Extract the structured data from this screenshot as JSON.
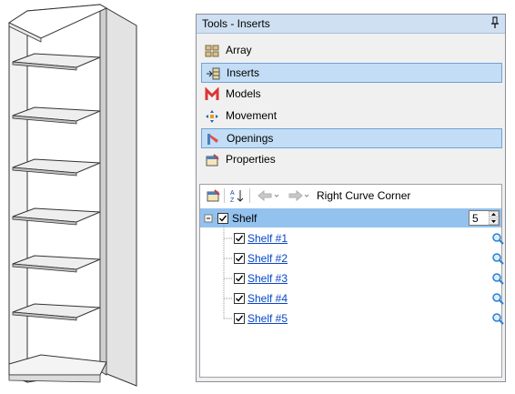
{
  "panel": {
    "title": "Tools - Inserts",
    "categories": [
      {
        "label": "Array",
        "icon": "array-icon",
        "selected": false
      },
      {
        "label": "Inserts",
        "icon": "inserts-icon",
        "selected": true
      },
      {
        "label": "Models",
        "icon": "models-icon",
        "selected": false
      },
      {
        "label": "Movement",
        "icon": "movement-icon",
        "selected": false
      },
      {
        "label": "Openings",
        "icon": "openings-icon",
        "selected": true
      },
      {
        "label": "Properties",
        "icon": "properties-icon",
        "selected": false
      }
    ]
  },
  "tree": {
    "breadcrumb": "Right Curve Corner",
    "root": {
      "label": "Shelf",
      "checked": true,
      "count": "5"
    },
    "children": [
      {
        "label": "Shelf #1",
        "checked": true
      },
      {
        "label": "Shelf #2",
        "checked": true
      },
      {
        "label": "Shelf #3",
        "checked": true
      },
      {
        "label": "Shelf #4",
        "checked": true
      },
      {
        "label": "Shelf #5",
        "checked": true
      }
    ]
  },
  "colors": {
    "accent": "#93c2ef",
    "selected_category": "#c2ddf5",
    "link": "#0645c8",
    "titlebar": "#cfe0f2"
  }
}
